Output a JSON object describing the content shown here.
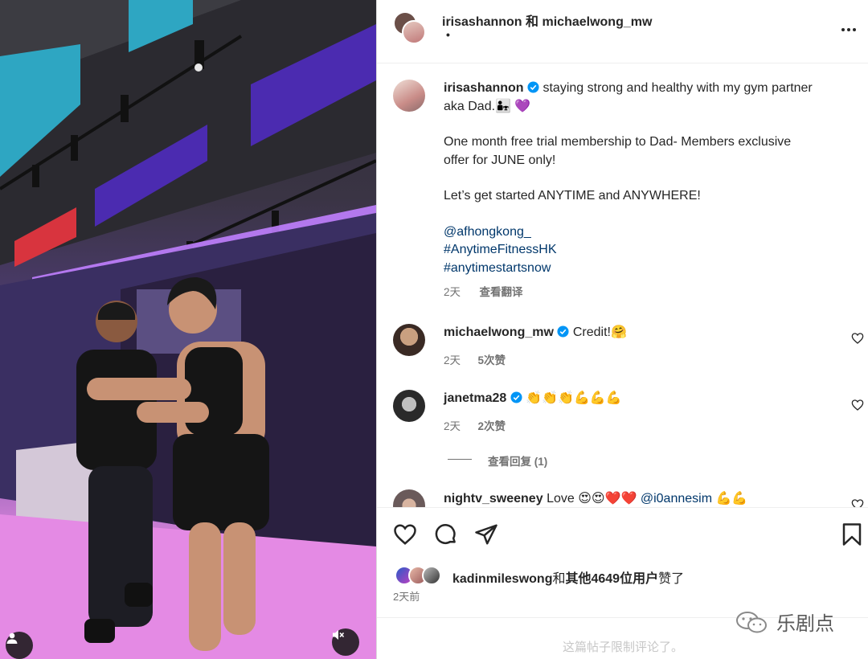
{
  "post": {
    "header": {
      "authors_prefix": "irisashannon",
      "authors_joiner": "和",
      "authors_second": "michaelwong_mw",
      "subline": "•"
    },
    "caption": {
      "username": "irisashannon",
      "line1": "staying strong and healthy with my gym partner",
      "line2": "aka Dad.👨‍👧 💜",
      "para2_line1": "One month free trial membership to Dad- Members exclusive",
      "para2_line2": "offer for JUNE only!",
      "para3": "Let’s get started ANYTIME and ANYWHERE!",
      "mention": "@afhongkong_",
      "tag1": "#AnytimeFitnessHK",
      "tag2": "#anytimestartsnow",
      "time": "2天",
      "translate": "查看翻译"
    },
    "comments": [
      {
        "username": "michaelwong_mw",
        "text": "Credit!🤗",
        "time": "2天",
        "likes": "5次赞"
      },
      {
        "username": "janetma28",
        "text": "👏👏👏💪💪💪",
        "time": "2天",
        "likes": "2次赞",
        "replies": "查看回复 (1)"
      },
      {
        "username": "nightv_sweeney",
        "text": "Love 😍😍❤️❤️",
        "mention": "@i0annesim",
        "emoji_tail": "💪💪"
      }
    ],
    "likes_line": {
      "user": "kadinmileswong",
      "joiner": "和",
      "others": "其他4649位用户",
      "suffix": "赞了"
    },
    "post_time": "2天前",
    "comments_limited": "这篇帖子限制评论了。",
    "watermark": "乐剧点"
  },
  "colors": {
    "verified": "#0095f6",
    "link": "#00376b",
    "meta": "#737373",
    "purple_heart": "#9b5de5"
  },
  "icons": [
    "like-icon",
    "comment-icon",
    "share-icon",
    "save-icon",
    "more-icon",
    "mute-icon",
    "user-tag-icon",
    "verified-icon"
  ]
}
